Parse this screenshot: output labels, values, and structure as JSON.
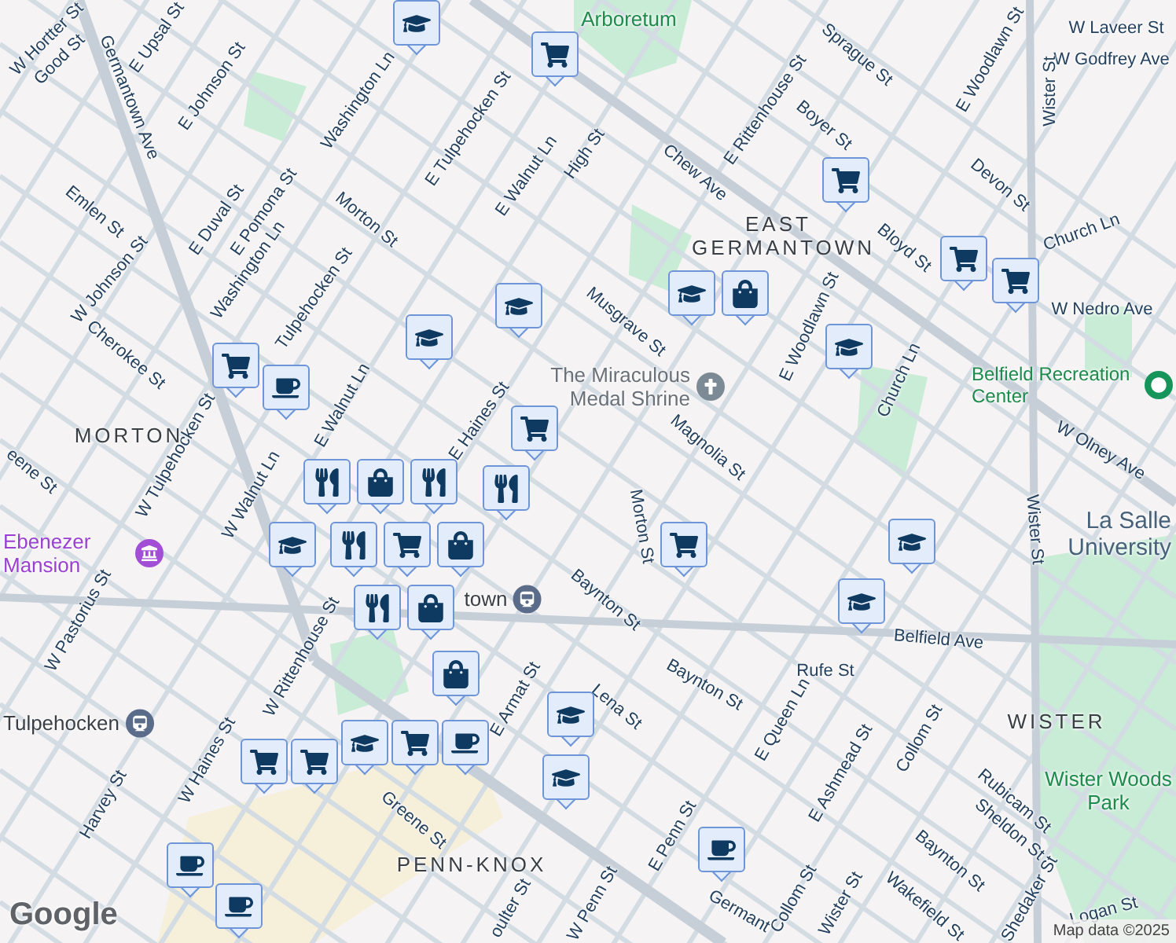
{
  "street_labels": [
    "W Hortter St",
    "Good St",
    "Germantown Ave",
    "E Upsal St",
    "E Johnson St",
    "Washington Ln",
    "E Tulpehocken St",
    "E Walnut Ln",
    "Emlen St",
    "E Duval St",
    "E Pomona St",
    "Washington Ln",
    "Morton St",
    "W Johnson St",
    "Cherokee St",
    "Tulpehocken St",
    "High St",
    "E Haines St",
    "Chew Ave",
    "E Rittenhouse St",
    "Sprague St",
    "Boyer St",
    "E Woodlawn St",
    "W Laveer St",
    "W Godfrey Ave",
    "Wister St",
    "Devon St",
    "Church Ln",
    "Bloyd St",
    "W Nedro Ave",
    "Musgrave St",
    "E Woodlawn St",
    "Church Ln",
    "Magnolia St",
    "W Olney Ave",
    "Morton St",
    "Baynton St",
    "Belfield Ave",
    "Rufe St",
    "Baynton St",
    "Lena St",
    "E Queen Ln",
    "E Ashmead St",
    "Collom St",
    "Rubicam St",
    "Sheldon St",
    "Baynton St",
    "Shedaker St",
    "Wakefield St",
    "Collom St",
    "Wister St",
    "E Penn St",
    "W Penn St",
    "Logan St",
    "Wister St",
    "E Armat St",
    "Greene St",
    "oulter St",
    "Harvey St",
    "W Haines St",
    "W Rittenhouse St",
    "W Pastorius St",
    "W Walnut Ln",
    "W Tulpehocken St",
    "eene St",
    "E Walnut Ln",
    "Germant"
  ],
  "places": [
    {
      "text": "Arboretum",
      "kind": "park"
    },
    {
      "text": "EAST GERMANTOWN",
      "kind": "district"
    },
    {
      "text": "The Miraculous Medal Shrine",
      "kind": "church"
    },
    {
      "text": "Belfield Recreation Center",
      "kind": "recreation"
    },
    {
      "text": "MORTON",
      "kind": "district"
    },
    {
      "text": "Ebenezer Mansion",
      "kind": "museum"
    },
    {
      "text": "La Salle University",
      "kind": "university"
    },
    {
      "text": "Tulpehocken",
      "kind": "station"
    },
    {
      "text": "WISTER",
      "kind": "district"
    },
    {
      "text": "Wister Woods Park",
      "kind": "park"
    },
    {
      "text": "PENN-KNOX",
      "kind": "district"
    },
    {
      "text": "town",
      "kind": "station"
    }
  ],
  "pins": [
    {
      "kind": "school"
    },
    {
      "kind": "cart"
    },
    {
      "kind": "cart"
    },
    {
      "kind": "school"
    },
    {
      "kind": "bag"
    },
    {
      "kind": "cart"
    },
    {
      "kind": "cart"
    },
    {
      "kind": "school"
    },
    {
      "kind": "school"
    },
    {
      "kind": "school"
    },
    {
      "kind": "cart"
    },
    {
      "kind": "cart"
    },
    {
      "kind": "coffee"
    },
    {
      "kind": "food"
    },
    {
      "kind": "school"
    },
    {
      "kind": "food"
    },
    {
      "kind": "bag"
    },
    {
      "kind": "food"
    },
    {
      "kind": "cart"
    },
    {
      "kind": "food"
    },
    {
      "kind": "bag"
    },
    {
      "kind": "food"
    },
    {
      "kind": "bag"
    },
    {
      "kind": "bag"
    },
    {
      "kind": "cart"
    },
    {
      "kind": "coffee"
    },
    {
      "kind": "school"
    },
    {
      "kind": "cart"
    },
    {
      "kind": "cart"
    },
    {
      "kind": "school"
    },
    {
      "kind": "school"
    },
    {
      "kind": "cart"
    },
    {
      "kind": "school"
    },
    {
      "kind": "school"
    },
    {
      "kind": "coffee"
    },
    {
      "kind": "coffee"
    },
    {
      "kind": "coffee"
    }
  ],
  "logo": "Google",
  "attribution": "Map data ©2025"
}
